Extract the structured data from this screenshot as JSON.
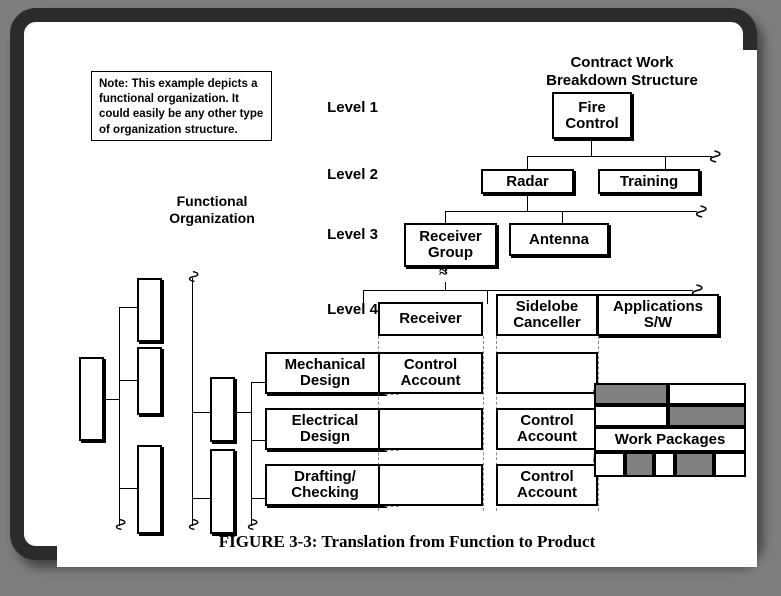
{
  "figure": {
    "caption": "FIGURE 3-3:  Translation from Function to Product"
  },
  "note": {
    "text": "Note:  This example depicts a functional organization.  It could easily be any other type of organization structure."
  },
  "wbs": {
    "title_line1": "Contract Work",
    "title_line2": "Breakdown Structure",
    "level_labels": [
      "Level 1",
      "Level 2",
      "Level 3",
      "Level 4"
    ],
    "level1": [
      "Fire Control"
    ],
    "level2": [
      "Radar",
      "Training"
    ],
    "level3": [
      "Receiver Group",
      "Antenna"
    ],
    "level4": [
      "Receiver",
      "Sidelobe Canceller",
      "Applications S/W"
    ],
    "continuation_marker": "break-squiggle"
  },
  "functional_org": {
    "title_line1": "Functional",
    "title_line2": "Organization",
    "leaf_boxes": [
      "Mechanical Design",
      "Electrical Design",
      "Drafting/ Checking"
    ],
    "unlabeled_box_count": 7
  },
  "matrix": {
    "column_headers": [
      "Receiver",
      "Sidelobe Canceller",
      "Applications S/W"
    ],
    "row_headers": [
      "Mechanical Design",
      "Electrical Design",
      "Drafting/ Checking"
    ],
    "cells": [
      [
        "Control Account",
        "",
        ""
      ],
      [
        "",
        "Control Account",
        ""
      ],
      [
        "",
        "Control Account",
        ""
      ]
    ]
  },
  "work_packages": {
    "label": "Work Packages",
    "row1": [
      {
        "fill": "gray"
      },
      {
        "fill": "white"
      }
    ],
    "row2": [
      {
        "fill": "white"
      },
      {
        "fill": "gray"
      }
    ],
    "row4": [
      {
        "fill": "white"
      },
      {
        "fill": "gray"
      },
      {
        "fill": "white"
      },
      {
        "fill": "gray"
      },
      {
        "fill": "white"
      }
    ]
  },
  "colors": {
    "page_background": "#7d7d7d",
    "frame": "#2b2b2b",
    "canvas": "#ffffff",
    "ink": "#000000",
    "work_package_fill": "#808080",
    "dashed_connector": "#8a8a8a"
  }
}
